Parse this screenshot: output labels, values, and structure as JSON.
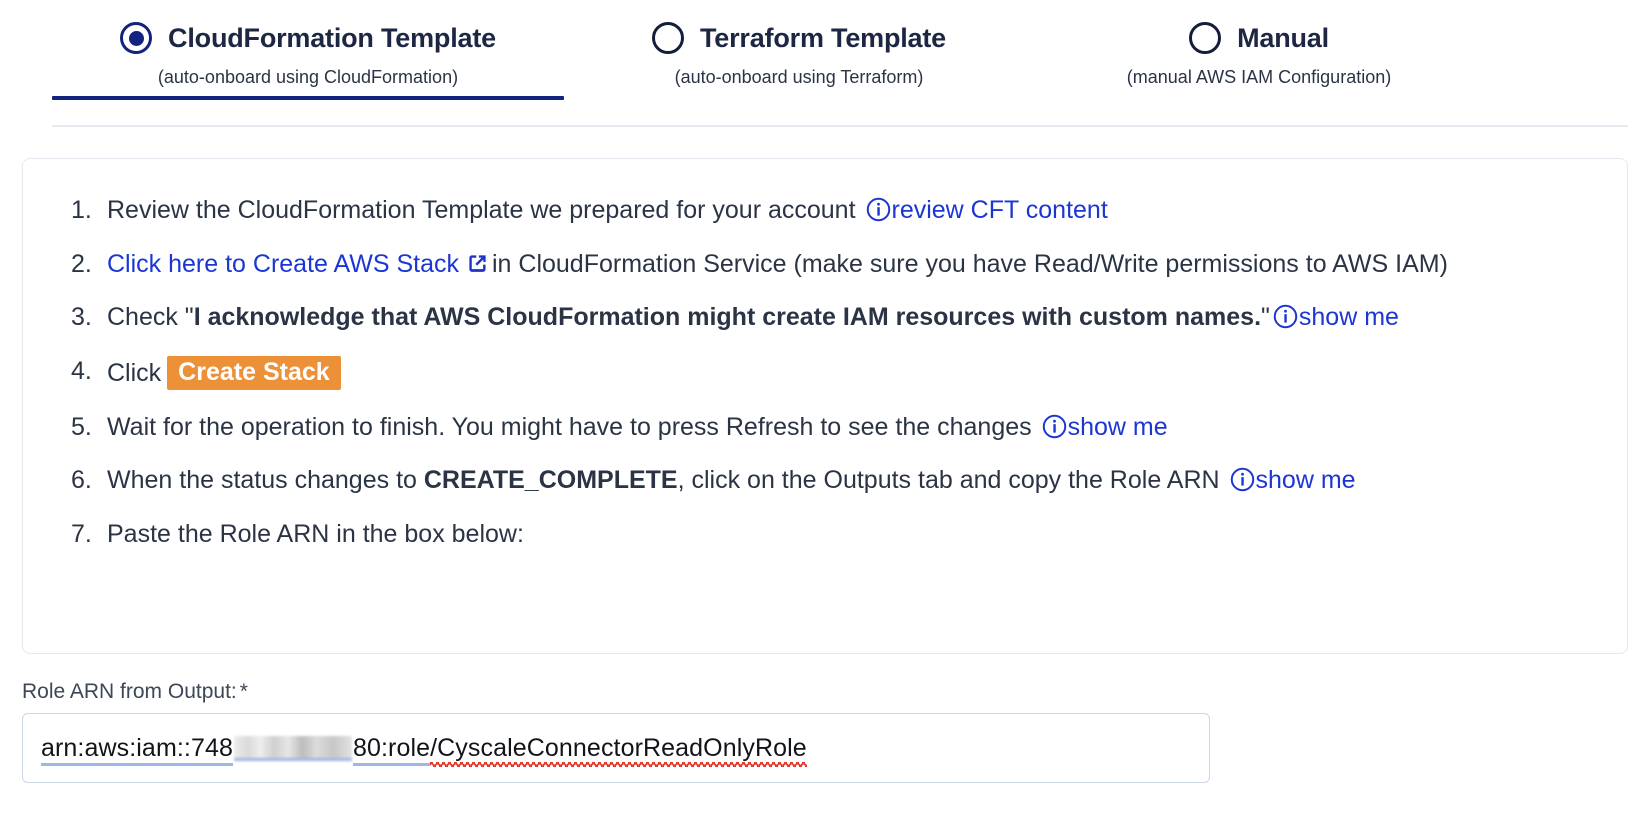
{
  "tabs": [
    {
      "label": "CloudFormation Template",
      "sublabel": "(auto-onboard using CloudFormation)",
      "selected": true
    },
    {
      "label": "Terraform Template",
      "sublabel": "(auto-onboard using Terraform)",
      "selected": false
    },
    {
      "label": "Manual",
      "sublabel": "(manual AWS IAM Configuration)",
      "selected": false
    }
  ],
  "steps": {
    "s1": {
      "num": "1.",
      "text": "Review the CloudFormation Template we prepared for your account",
      "info_icon": "info-circle-icon",
      "link": "review CFT content"
    },
    "s2": {
      "num": "2.",
      "link": "Click here to Create AWS Stack",
      "ext_icon": "external-link-icon",
      "text": "in CloudFormation Service (make sure you have Read/Write permissions to AWS IAM)"
    },
    "s3": {
      "num": "3.",
      "prefix": "Check \"",
      "bold": "I acknowledge that AWS CloudFormation might create IAM resources with custom names.",
      "suffix": "\"",
      "info_icon": "info-circle-icon",
      "link": "show me"
    },
    "s4": {
      "num": "4.",
      "text": "Click",
      "badge": "Create Stack",
      "badge_color": "#ed9138"
    },
    "s5": {
      "num": "5.",
      "text": "Wait for the operation to finish. You might have to press Refresh to see the changes",
      "info_icon": "info-circle-icon",
      "link": "show me"
    },
    "s6": {
      "num": "6.",
      "prefix": "When the status changes to",
      "bold": "CREATE_COMPLETE",
      "suffix": ", click on the Outputs tab and copy the Role ARN",
      "info_icon": "info-circle-icon",
      "link": "show me"
    },
    "s7": {
      "num": "7.",
      "text": "Paste the Role ARN in the box below:"
    }
  },
  "form": {
    "label": "Role ARN from Output:",
    "required_marker": "*",
    "arn_prefix": "arn:aws:iam::748",
    "arn_redacted": "redacted-account-id",
    "arn_suffix": "80:role/CyscaleConnectorReadOnlyRole"
  },
  "colors": {
    "accent_blue": "#12227e",
    "link_blue": "#1b36d4",
    "badge_orange": "#ed9138",
    "text": "#2b3445",
    "border": "#e5e8ee"
  }
}
